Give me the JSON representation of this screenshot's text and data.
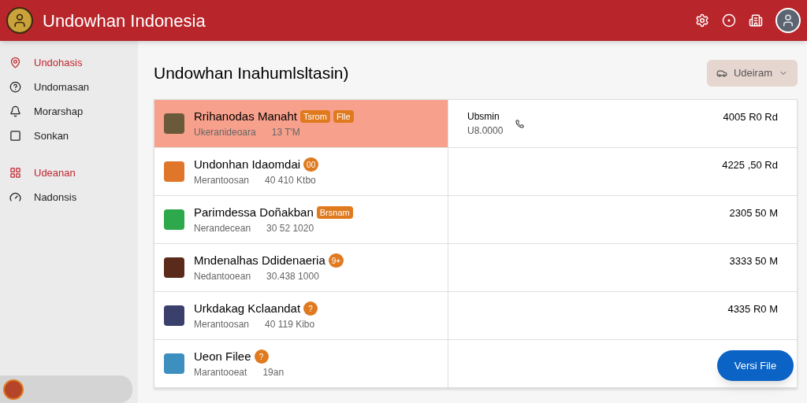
{
  "header": {
    "title": "Undowhan Indonesia"
  },
  "sidebar": {
    "groups": [
      [
        {
          "label": "Undohasis",
          "active": true
        },
        {
          "label": "Undomasan",
          "active": false
        },
        {
          "label": "Morarshap",
          "active": false
        },
        {
          "label": "Sonkan",
          "active": false
        }
      ],
      [
        {
          "label": "Udeanan",
          "active": true
        },
        {
          "label": "Nadonsis",
          "active": false
        }
      ]
    ]
  },
  "main": {
    "title": "Undowhan Inahumlsltasin)",
    "filter_button": "Udeiram"
  },
  "table": {
    "rows": [
      {
        "name": "Rrihanodas Manaht",
        "badges": [
          {
            "kind": "tag",
            "text": "Tsrom"
          },
          {
            "kind": "tag",
            "text": "Flle"
          }
        ],
        "subtitle": "Ukeranideoara",
        "size": "13 T'M",
        "detail": {
          "title": "Ubsmin",
          "value": "U8.0000"
        },
        "amount": "4005 R0 Rd",
        "selected": true
      },
      {
        "name": "Undonhan Idaomdai",
        "badges": [
          {
            "kind": "dot",
            "text": "00"
          }
        ],
        "subtitle": "Merantoosan",
        "size": "40 410 Ktbo",
        "amount": "4225 ,50 Rd",
        "selected": false
      },
      {
        "name": "Parimdessa Doñakban",
        "badges": [
          {
            "kind": "tag",
            "text": "Brsnam"
          }
        ],
        "subtitle": "Nerandecean",
        "size": "30 52 1020",
        "amount": "2305 50 M",
        "selected": false
      },
      {
        "name": "Mndenalhas Ddidenaeria",
        "badges": [
          {
            "kind": "dot",
            "text": "9+"
          }
        ],
        "subtitle": "Nedantooean",
        "size": "30.438 1000",
        "amount": "3333 50 M",
        "selected": false
      },
      {
        "name": "Urkdakag Kclaandat",
        "badges": [
          {
            "kind": "dot",
            "text": "?"
          }
        ],
        "subtitle": "Merantoosan",
        "size": "40 119 Kibo",
        "amount": "4335 R0 M",
        "selected": false
      },
      {
        "name": "Ueon Filee",
        "badges": [
          {
            "kind": "dot",
            "text": "?"
          }
        ],
        "subtitle": "Marantooeat",
        "size": "19an",
        "selected": false
      }
    ]
  },
  "fab": {
    "label": "Versi File"
  }
}
